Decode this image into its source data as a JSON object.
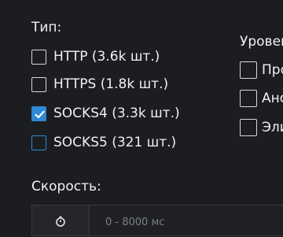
{
  "type_section": {
    "title": "Тип:",
    "items": [
      {
        "label": "HTTP (3.6k шт.)",
        "checked": false
      },
      {
        "label": "HTTPS (1.8k шт.)",
        "checked": false
      },
      {
        "label": "SOCKS4 (3.3k шт.)",
        "checked": true
      },
      {
        "label": "SOCKS5 (321 шт.)",
        "checked": false
      }
    ]
  },
  "level_section": {
    "title": "Уровен",
    "items": [
      {
        "label": "Про",
        "checked": false
      },
      {
        "label": "Ано",
        "checked": false
      },
      {
        "label": "Эли",
        "checked": false
      }
    ]
  },
  "speed_section": {
    "title": "Скорость:",
    "placeholder": "0 - 8000 мс",
    "icon": "stopwatch-icon"
  },
  "colors": {
    "background": "#1c1d21",
    "accent": "#2f88d8",
    "text": "#f1f1f1"
  }
}
